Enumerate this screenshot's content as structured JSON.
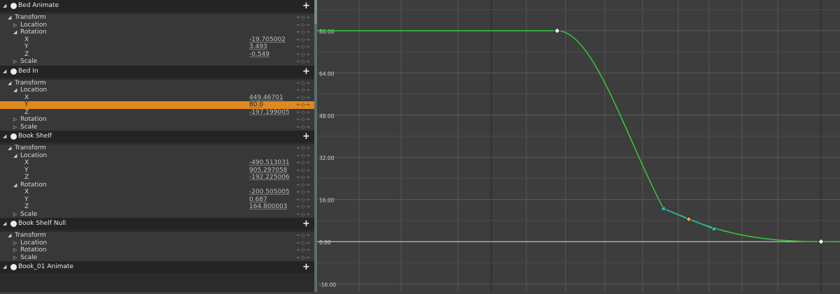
{
  "tree": [
    {
      "kind": "object",
      "name": "Bed Animate"
    },
    {
      "kind": "group",
      "depth": 1,
      "expanded": true,
      "name": "Transform"
    },
    {
      "kind": "group",
      "depth": 2,
      "expanded": false,
      "name": "Location"
    },
    {
      "kind": "group",
      "depth": 2,
      "expanded": true,
      "name": "Rotation"
    },
    {
      "kind": "channel",
      "depth": 3,
      "name": "X",
      "value": "-19.705002"
    },
    {
      "kind": "channel",
      "depth": 3,
      "name": "Y",
      "value": "3.493"
    },
    {
      "kind": "channel",
      "depth": 3,
      "name": "Z",
      "value": "-0.549"
    },
    {
      "kind": "group",
      "depth": 2,
      "expanded": false,
      "name": "Scale"
    },
    {
      "kind": "object",
      "name": "Bed In"
    },
    {
      "kind": "group",
      "depth": 1,
      "expanded": true,
      "name": "Transform"
    },
    {
      "kind": "group",
      "depth": 2,
      "expanded": true,
      "name": "Location"
    },
    {
      "kind": "channel",
      "depth": 3,
      "name": "X",
      "value": "449.46701"
    },
    {
      "kind": "channel",
      "depth": 3,
      "name": "Y",
      "value": "80.0",
      "selected": true
    },
    {
      "kind": "channel",
      "depth": 3,
      "name": "Z",
      "value": "-197.199005"
    },
    {
      "kind": "group",
      "depth": 2,
      "expanded": false,
      "name": "Rotation"
    },
    {
      "kind": "group",
      "depth": 2,
      "expanded": false,
      "name": "Scale"
    },
    {
      "kind": "object",
      "name": "Book Shelf"
    },
    {
      "kind": "group",
      "depth": 1,
      "expanded": true,
      "name": "Transform"
    },
    {
      "kind": "group",
      "depth": 2,
      "expanded": true,
      "name": "Location"
    },
    {
      "kind": "channel",
      "depth": 3,
      "name": "X",
      "value": "-490.513031"
    },
    {
      "kind": "channel",
      "depth": 3,
      "name": "Y",
      "value": "905.297058"
    },
    {
      "kind": "channel",
      "depth": 3,
      "name": "Z",
      "value": "-192.225006"
    },
    {
      "kind": "group",
      "depth": 2,
      "expanded": true,
      "name": "Rotation"
    },
    {
      "kind": "channel",
      "depth": 3,
      "name": "X",
      "value": "-200.505005"
    },
    {
      "kind": "channel",
      "depth": 3,
      "name": "Y",
      "value": "0.687"
    },
    {
      "kind": "channel",
      "depth": 3,
      "name": "Z",
      "value": "164.800003"
    },
    {
      "kind": "group",
      "depth": 2,
      "expanded": false,
      "name": "Scale"
    },
    {
      "kind": "object",
      "name": "Book Shelf Null"
    },
    {
      "kind": "group",
      "depth": 1,
      "expanded": true,
      "name": "Transform"
    },
    {
      "kind": "group",
      "depth": 2,
      "expanded": false,
      "name": "Location"
    },
    {
      "kind": "group",
      "depth": 2,
      "expanded": false,
      "name": "Rotation"
    },
    {
      "kind": "group",
      "depth": 2,
      "expanded": false,
      "name": "Scale"
    },
    {
      "kind": "object",
      "name": "Book_01 Animate"
    }
  ],
  "icons": {
    "expanded": "◢",
    "collapsed": "▷",
    "add": "+",
    "key_controls": "⇠◇⇢",
    "key_controls_names": [
      "previous-key-icon",
      "add-key-icon",
      "next-key-icon"
    ]
  },
  "colors": {
    "selection": "#e08a1e",
    "curve": "#35c93a",
    "tangent": "#2fb7b3",
    "selected_key": "#f09a3a",
    "zero_line": "#e0e0e0"
  },
  "graph": {
    "y_labels": [
      "80.00",
      "64.00",
      "48.00",
      "32.00",
      "16.00",
      "0.00",
      "-16.00"
    ],
    "y_values": [
      80,
      64,
      48,
      32,
      16,
      0,
      -16
    ],
    "curve": {
      "keys": [
        {
          "value": 80,
          "selected": false
        },
        {
          "value": 8.5,
          "selected": true
        },
        {
          "value": 0,
          "selected": false
        }
      ],
      "tangent_handles": [
        {
          "value": 12.5
        },
        {
          "value": 4.8
        }
      ]
    }
  }
}
